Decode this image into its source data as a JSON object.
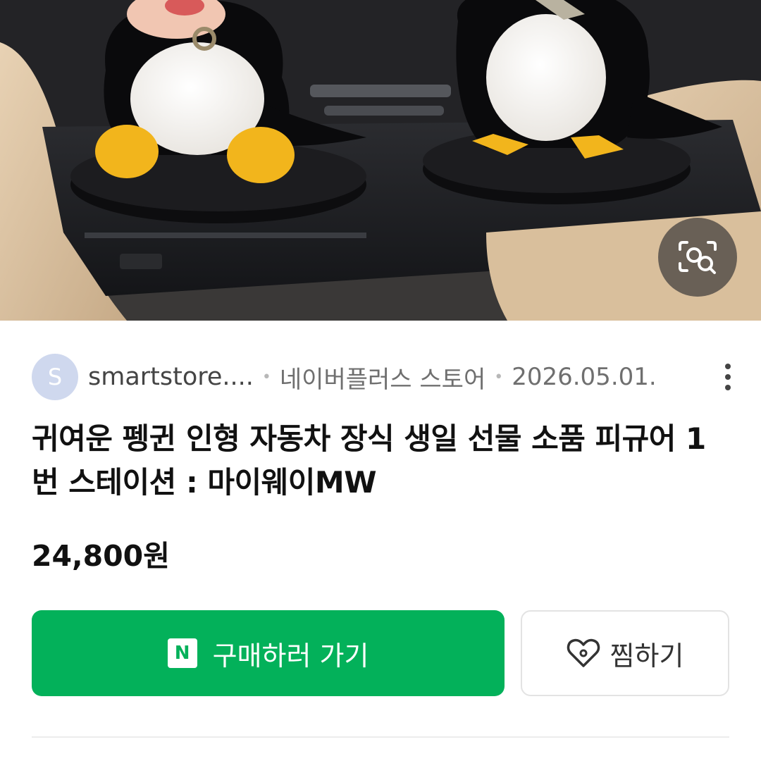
{
  "result": {
    "image": {
      "alt": "penguin figures in car cup holders",
      "lens_icon": "image-search-icon"
    },
    "source": {
      "avatar_letter": "S",
      "site": "smartstore....",
      "separator": "•",
      "store": "네이버플러스 스토어",
      "date": "2026.05.01.",
      "more_icon": "more-vertical-icon"
    },
    "title": "귀여운 펭귄 인형 자동차 장식 생일 선물 소품 피규어 1번 스테이션 : 마이웨이MW",
    "price": "24,800원",
    "buy_button": {
      "badge": "N",
      "label": "구매하러 가기",
      "color": "#03b15a"
    },
    "wish_button": {
      "icon": "heart-tag-icon",
      "label": "찜하기"
    }
  }
}
